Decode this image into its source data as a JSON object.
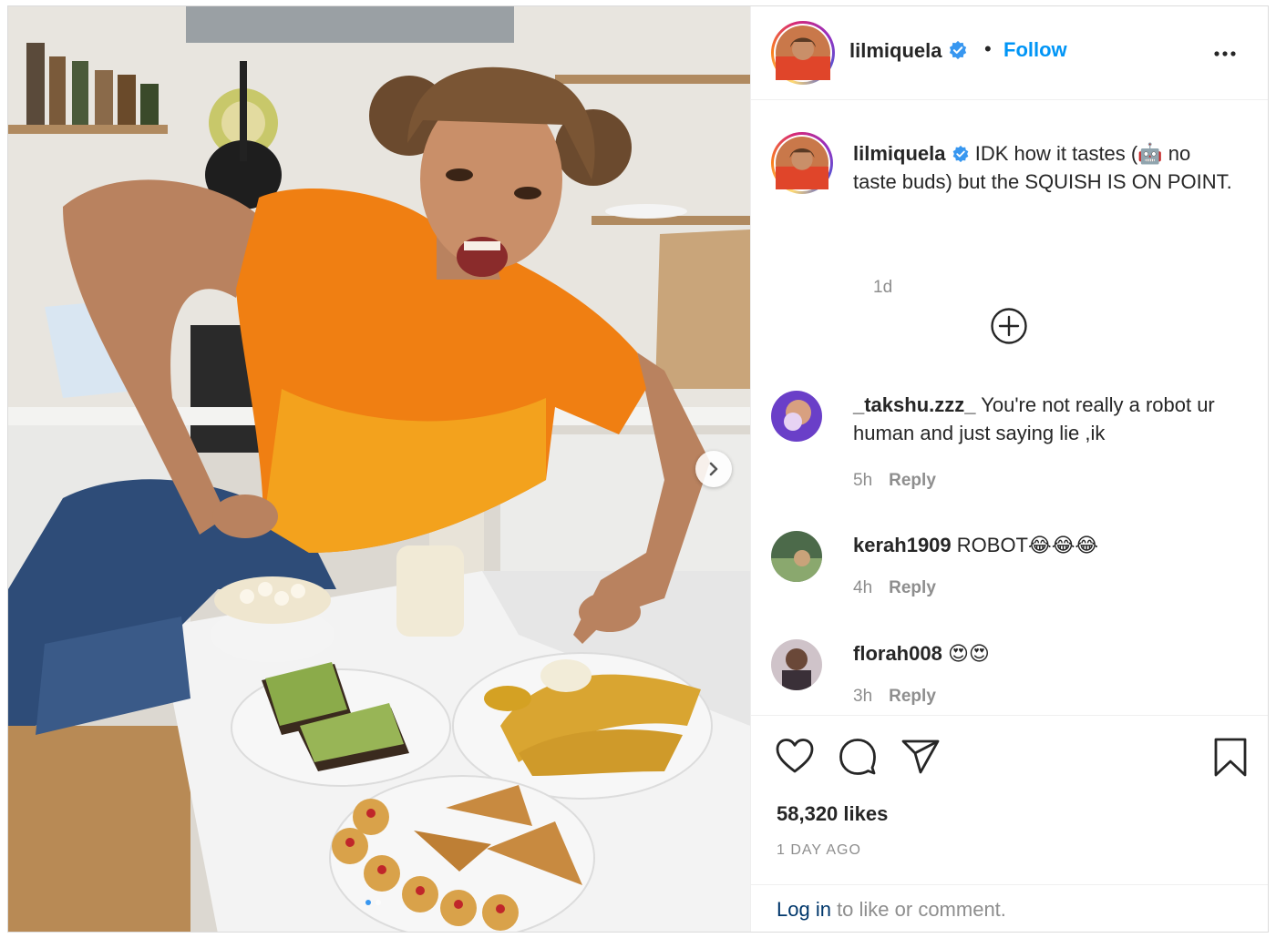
{
  "post": {
    "username": "lilmiquela",
    "follow_label": "Follow",
    "separator": "•",
    "caption": {
      "username": "lilmiquela",
      "text_before_emoji": " IDK how it tastes (",
      "emoji": "🤖",
      "text_after_emoji": " no taste buds) but the SQUISH IS ON POINT.",
      "time": "1d"
    },
    "comments": [
      {
        "username": "_takshu.zzz_",
        "text": " You're not really a robot ur human and just saying lie ,ik",
        "time": "5h",
        "reply_label": "Reply"
      },
      {
        "username": "kerah1909",
        "text": " ROBOT😂😂😂",
        "time": "4h",
        "reply_label": "Reply"
      },
      {
        "username": "florah008",
        "text": " 😍😍",
        "time": "3h",
        "reply_label": "Reply"
      }
    ],
    "likes_text": "58,320 likes",
    "posted_ago": "1 DAY AGO",
    "login_link": "Log in",
    "login_rest": " to like or comment.",
    "carousel": {
      "slide_count": 2,
      "active_slide": 1
    }
  },
  "colors": {
    "link_blue": "#0095f6",
    "verified_blue": "#3897f0",
    "muted_gray": "#8e8e8e",
    "text_dark": "#262626",
    "login_link": "#00376b"
  },
  "icons": [
    "verified-badge-icon",
    "more-options-icon",
    "load-more-comments-icon",
    "like-heart-icon",
    "comment-bubble-icon",
    "share-paper-plane-icon",
    "save-bookmark-icon",
    "next-slide-chevron-icon"
  ]
}
